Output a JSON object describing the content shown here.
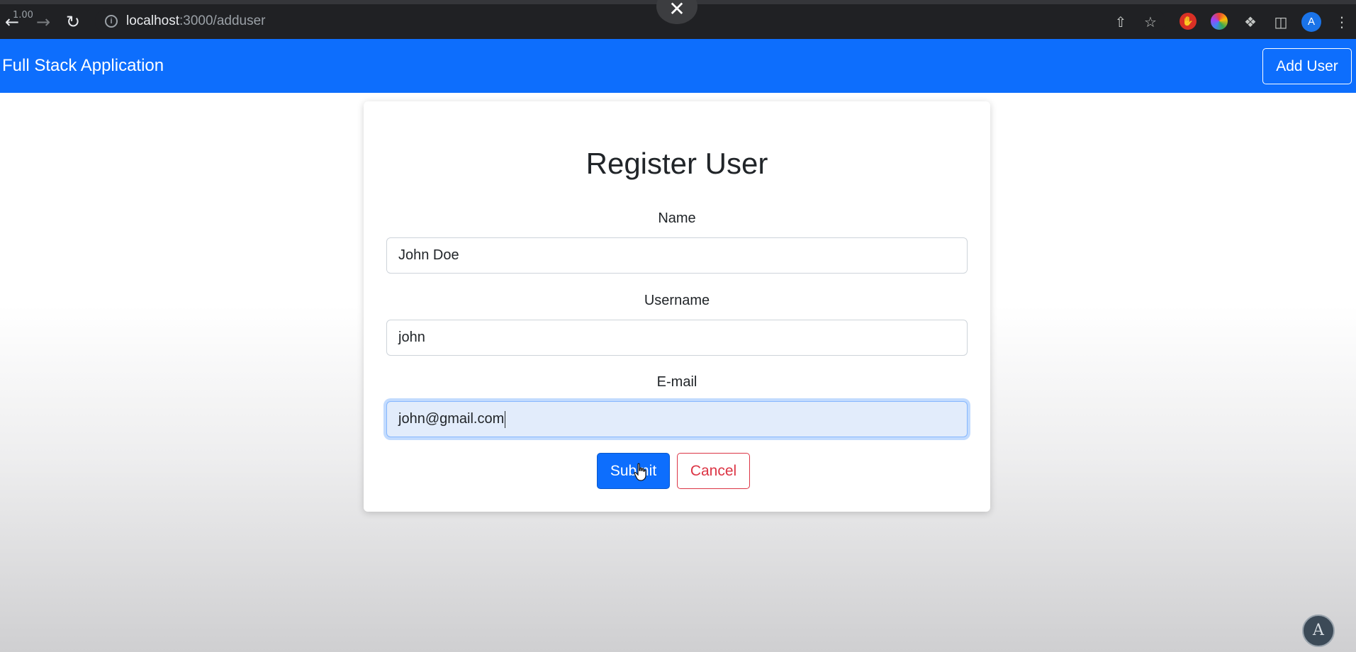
{
  "browser": {
    "zoom": "1.00",
    "url_host": "localhost",
    "url_path": ":3000/adduser",
    "profile_initial": "A",
    "icons": [
      "back-icon",
      "forward-icon",
      "reload-icon",
      "info-icon",
      "share-icon",
      "star-icon",
      "extension-icon",
      "sidebar-icon",
      "menu-icon"
    ]
  },
  "navbar": {
    "brand": "Full Stack Application",
    "add_user_label": "Add User",
    "color": "#0d6efd"
  },
  "form": {
    "title": "Register User",
    "fields": [
      {
        "label": "Name",
        "value": "John Doe"
      },
      {
        "label": "Username",
        "value": "john"
      },
      {
        "label": "E-mail",
        "value": "john@gmail.com"
      }
    ],
    "submit_label": "Submit",
    "cancel_label": "Cancel"
  },
  "watermark": {
    "letter": "A"
  }
}
